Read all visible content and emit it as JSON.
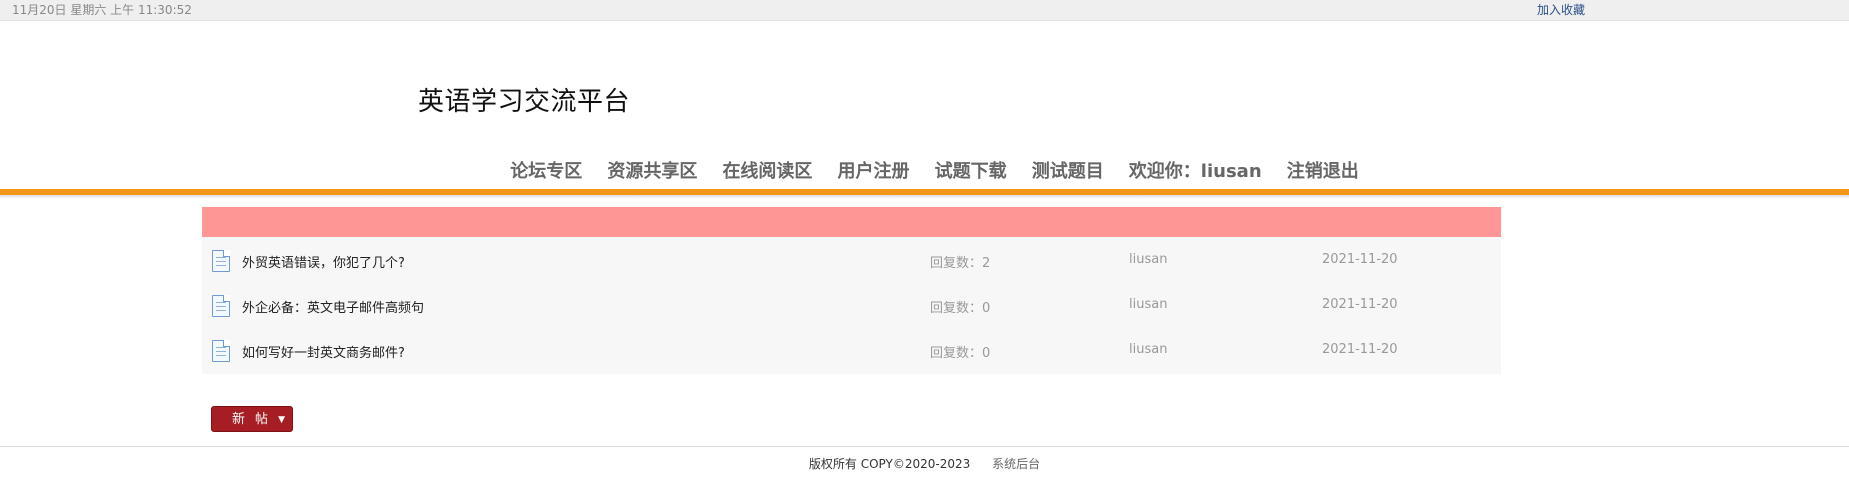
{
  "topbar": {
    "datetime": "11月20日 星期六 上午 11:30:52",
    "favorite": "加入收藏"
  },
  "header": {
    "site_title": "英语学习交流平台"
  },
  "nav": {
    "items": [
      "论坛专区",
      "资源共享区",
      "在线阅读区",
      "用户注册",
      "试题下载",
      "测试题目",
      "欢迎你：liusan",
      "注销退出"
    ]
  },
  "theme": {
    "accent": "#f39517",
    "board_header": "#ff9696",
    "button": "#a61d24"
  },
  "posts": [
    {
      "icon": "document-icon",
      "title": "外贸英语错误，你犯了几个?",
      "replies": "回复数：2",
      "author": "liusan",
      "date": "2021-11-20"
    },
    {
      "icon": "document-icon",
      "title": "外企必备：英文电子邮件高频句",
      "replies": "回复数：0",
      "author": "liusan",
      "date": "2021-11-20"
    },
    {
      "icon": "document-icon",
      "title": "如何写好一封英文商务邮件?",
      "replies": "回复数：0",
      "author": "liusan",
      "date": "2021-11-20"
    }
  ],
  "actions": {
    "new_post": "新帖",
    "dropdown": "▼"
  },
  "footer": {
    "copyright": "版权所有 COPY©2020-2023",
    "admin": "系统后台"
  }
}
